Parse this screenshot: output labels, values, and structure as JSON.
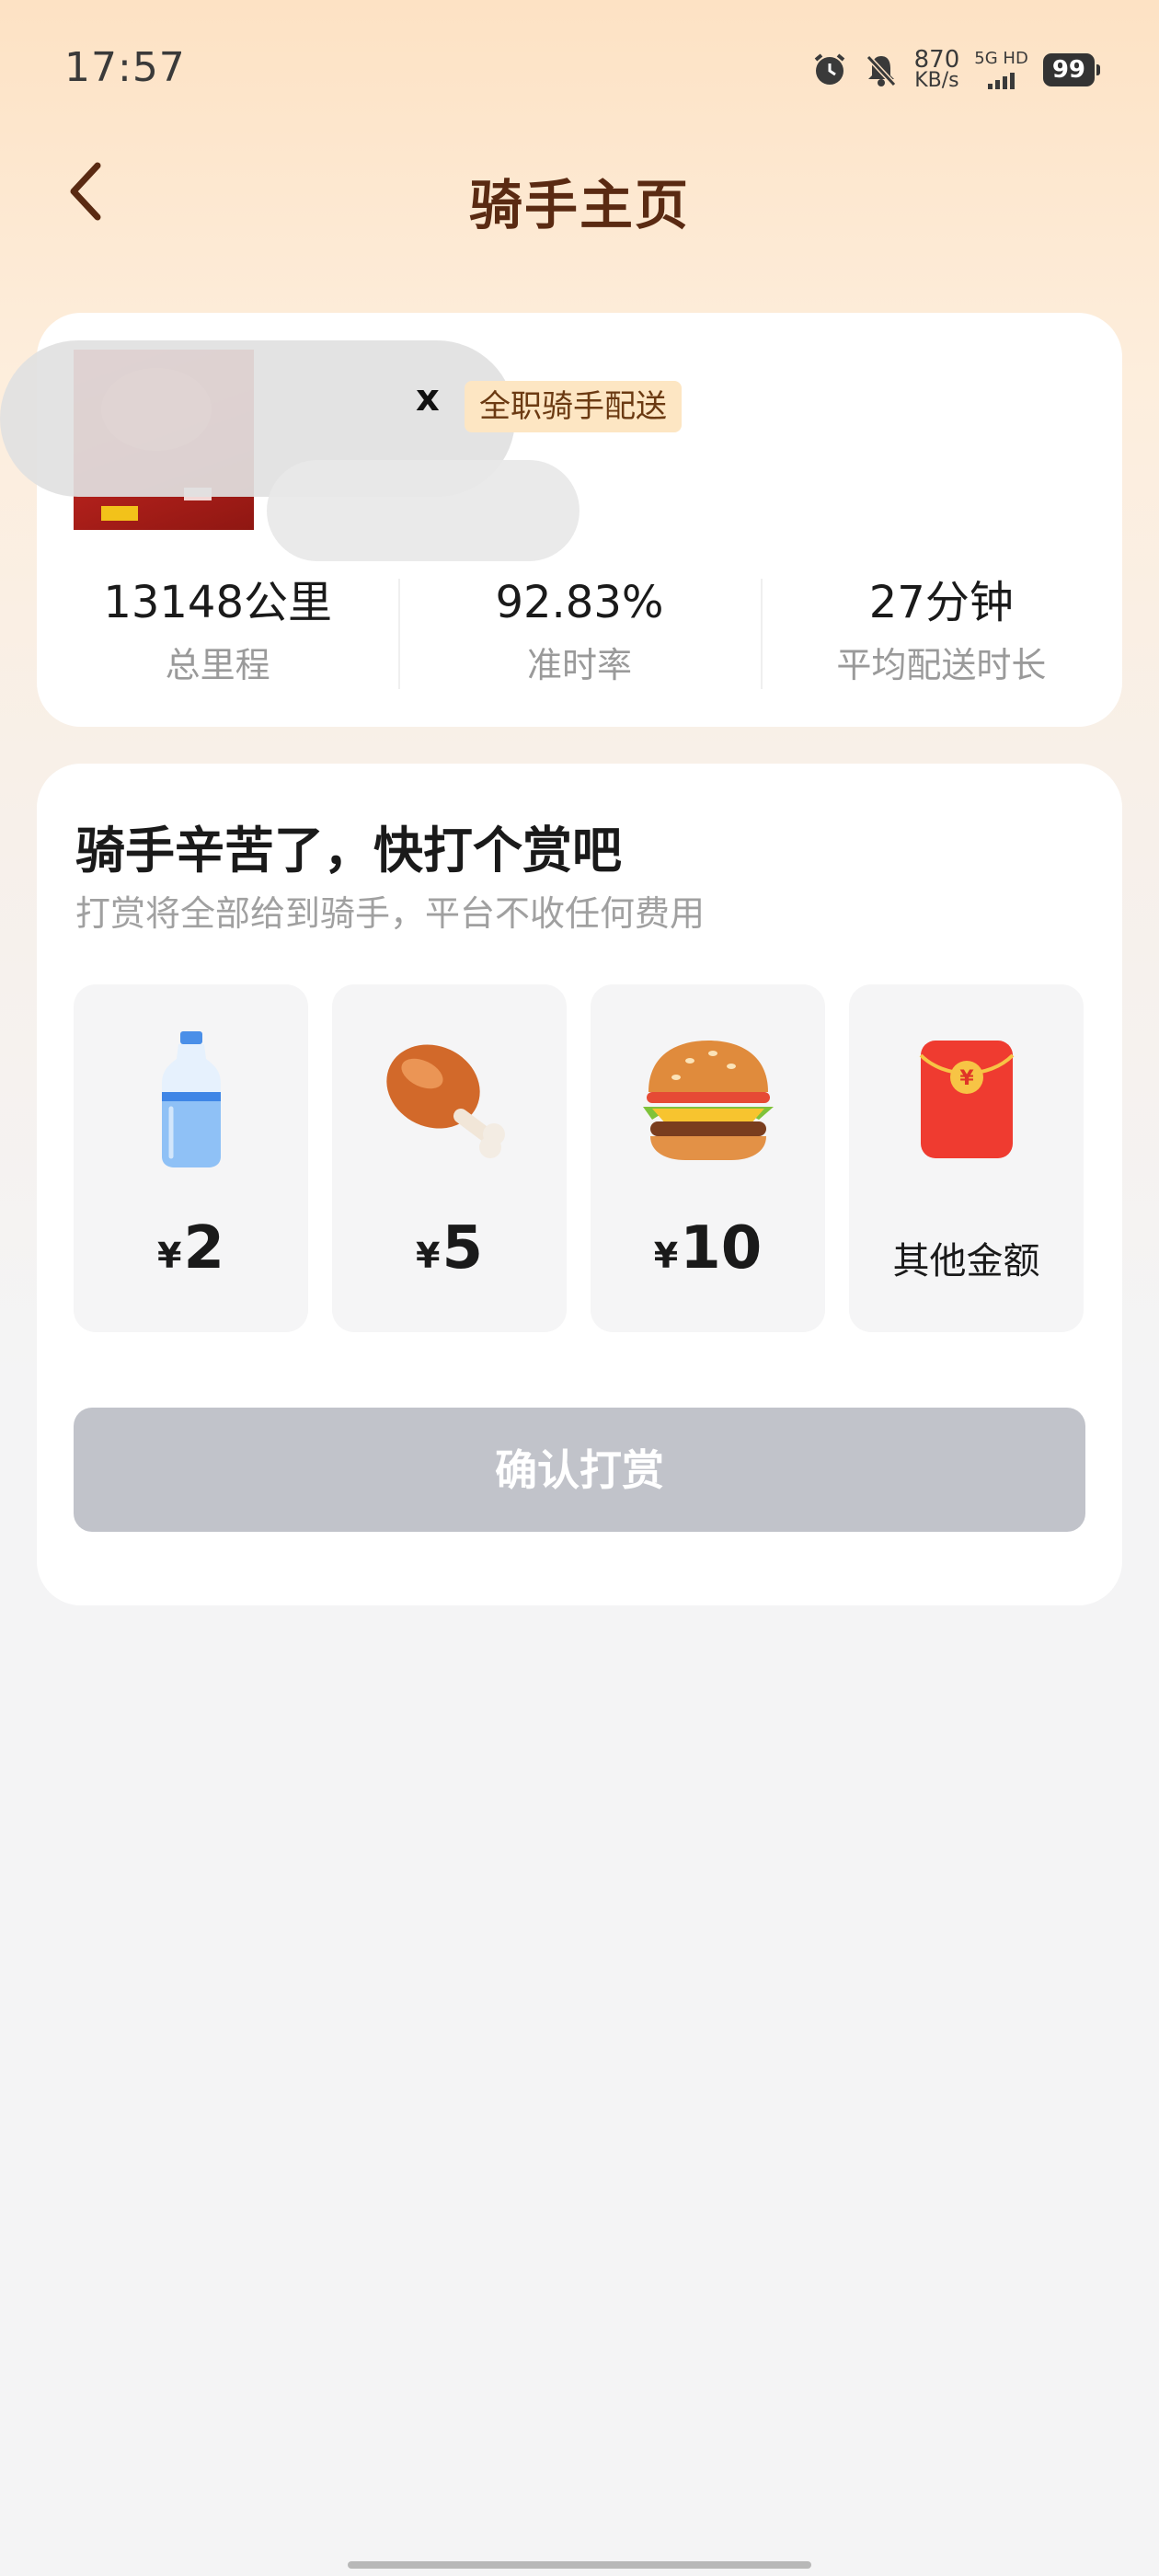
{
  "status_bar": {
    "time": "17:57",
    "net_speed_value": "870",
    "net_speed_unit": "KB/s",
    "network": "5G HD",
    "battery": "99"
  },
  "nav": {
    "title": "骑手主页",
    "back_icon": "chevron-left-icon"
  },
  "rider": {
    "name_visible_fragment": "x",
    "badge": "全职骑手配送",
    "stats": [
      {
        "value": "13148公里",
        "label": "总里程"
      },
      {
        "value": "92.83%",
        "label": "准时率"
      },
      {
        "value": "27分钟",
        "label": "平均配送时长"
      }
    ]
  },
  "tip": {
    "title": "骑手辛苦了，快打个赏吧",
    "subtitle": "打赏将全部给到骑手，平台不收任何费用",
    "currency": "¥",
    "options": [
      {
        "icon": "water-bottle-icon",
        "amount": "2"
      },
      {
        "icon": "chicken-drumstick-icon",
        "amount": "5"
      },
      {
        "icon": "burger-icon",
        "amount": "10"
      },
      {
        "icon": "red-envelope-icon",
        "label": "其他金额"
      }
    ],
    "confirm_label": "确认打赏"
  },
  "colors": {
    "title": "#5a2a12",
    "badge_bg": "#fde6c3",
    "button_disabled": "#c1c3ca"
  }
}
